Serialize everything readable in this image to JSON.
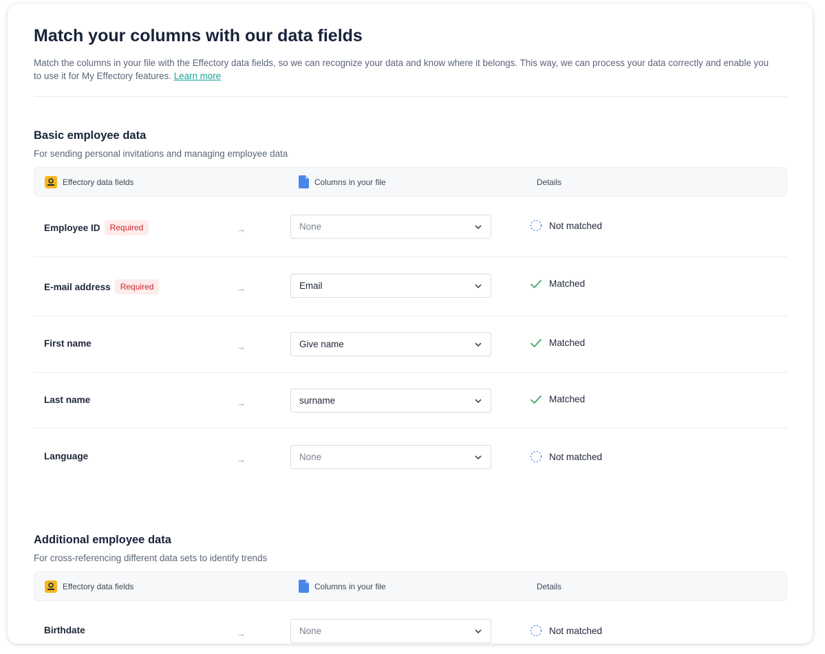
{
  "header": {
    "title": "Match your columns with our data fields",
    "intro": "Match the columns in your file with the Effectory data fields, so we can recognize your data and know where it belongs. This way, we can process your data correctly and enable you to use it for My Effectory features.",
    "learn_more": "Learn more"
  },
  "columns": {
    "fields": "Effectory data fields",
    "file": "Columns in your file",
    "details": "Details"
  },
  "colors": {
    "required_text": "#c8252b",
    "required_bg": "#fdecec",
    "matched_check": "#3fa767",
    "link": "#1aa39a",
    "user_icon": "#f5b91e",
    "file_icon": "#4a86e8"
  },
  "sections": [
    {
      "title": "Basic employee data",
      "subtitle": "For sending personal invitations and managing employee data",
      "rows": [
        {
          "field": "Employee ID",
          "required": "Required",
          "value": "None",
          "status": "Not matched",
          "matched": false
        },
        {
          "field": "E-mail address",
          "required": "Required",
          "value": "Email",
          "status": "Matched",
          "matched": true
        },
        {
          "field": "First name",
          "value": "Give name",
          "status": "Matched",
          "matched": true
        },
        {
          "field": "Last name",
          "value": "surname",
          "status": "Matched",
          "matched": true
        },
        {
          "field": "Language",
          "value": "None",
          "status": "Not matched",
          "matched": false
        }
      ]
    },
    {
      "title": "Additional employee data",
      "subtitle": "For cross-referencing different data sets to identify trends",
      "rows": [
        {
          "field": "Birthdate",
          "value": "None",
          "status": "Not matched",
          "matched": false
        }
      ]
    }
  ]
}
